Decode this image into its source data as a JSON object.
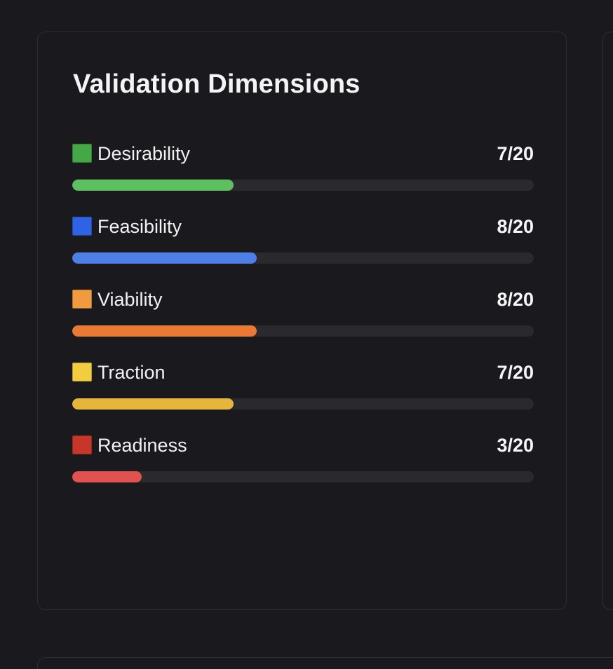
{
  "card": {
    "title": "Validation Dimensions"
  },
  "dimensions": [
    {
      "label": "Desirability",
      "score_text": "7/20",
      "score": 7,
      "max": 20,
      "color": "#5cbf60",
      "swatch": "#43a845"
    },
    {
      "label": "Feasibility",
      "score_text": "8/20",
      "score": 8,
      "max": 20,
      "color": "#4d7fe6",
      "swatch": "#2f62e4"
    },
    {
      "label": "Viability",
      "score_text": "8/20",
      "score": 8,
      "max": 20,
      "color": "#e87a35",
      "swatch": "#f29a3f"
    },
    {
      "label": "Traction",
      "score_text": "7/20",
      "score": 7,
      "max": 20,
      "color": "#e5b53c",
      "swatch": "#f2cd3f"
    },
    {
      "label": "Readiness",
      "score_text": "3/20",
      "score": 3,
      "max": 20,
      "color": "#e0514f",
      "swatch": "#c8362a"
    }
  ]
}
